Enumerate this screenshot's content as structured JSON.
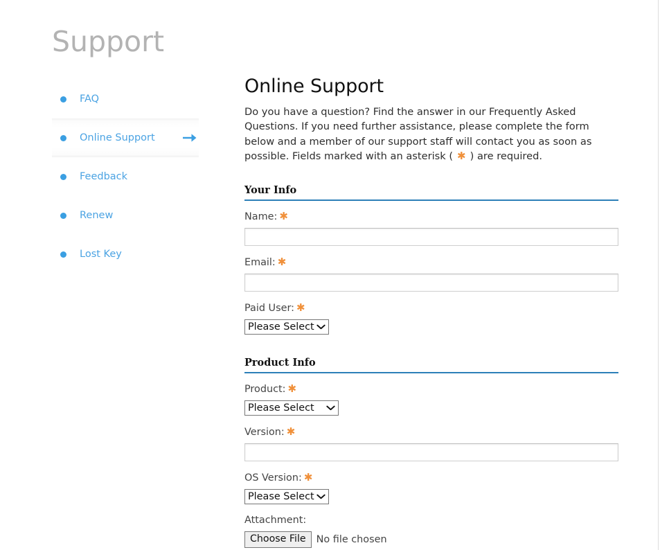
{
  "page": {
    "title": "Support"
  },
  "sidebar": {
    "items": [
      {
        "label": "FAQ",
        "active": false,
        "arrow": false
      },
      {
        "label": "Online Support",
        "active": true,
        "arrow": true
      },
      {
        "label": "Feedback",
        "active": false,
        "arrow": false
      },
      {
        "label": "Renew",
        "active": false,
        "arrow": false
      },
      {
        "label": "Lost Key",
        "active": false,
        "arrow": false
      }
    ]
  },
  "main": {
    "heading": "Online Support",
    "intro_part1": "Do you have a question? Find the answer in our Frequently Asked Questions. If you need further assistance, please complete the form below and a member of our support staff will contact you as soon as possible. Fields marked with an asterisk (",
    "intro_asterisk": "✱",
    "intro_part2": ") are required."
  },
  "form": {
    "sections": [
      {
        "title": "Your Info",
        "fields": [
          {
            "label": "Name:",
            "required": true,
            "type": "text",
            "value": "",
            "placeholder": ""
          },
          {
            "label": "Email:",
            "required": true,
            "type": "text",
            "value": "",
            "placeholder": ""
          },
          {
            "label": "Paid User:",
            "required": true,
            "type": "select",
            "value": "Please Select"
          }
        ]
      },
      {
        "title": "Product Info",
        "fields": [
          {
            "label": "Product:",
            "required": true,
            "type": "select",
            "value": "Please Select",
            "wide": true
          },
          {
            "label": "Version:",
            "required": true,
            "type": "text",
            "value": "",
            "placeholder": ""
          },
          {
            "label": "OS Version:",
            "required": true,
            "type": "select",
            "value": "Please Select"
          },
          {
            "label": "Attachment:",
            "required": false,
            "type": "file",
            "button_label": "Choose File",
            "status": "No file chosen"
          }
        ]
      }
    ],
    "required_mark": "✱",
    "chevron": "❯"
  },
  "colors": {
    "link_blue": "#4ba3e3",
    "bullet_blue": "#3b9fe2",
    "rule_blue": "#2c7fb8",
    "required_orange": "#f0903a",
    "title_gray": "#b3b3b3"
  }
}
